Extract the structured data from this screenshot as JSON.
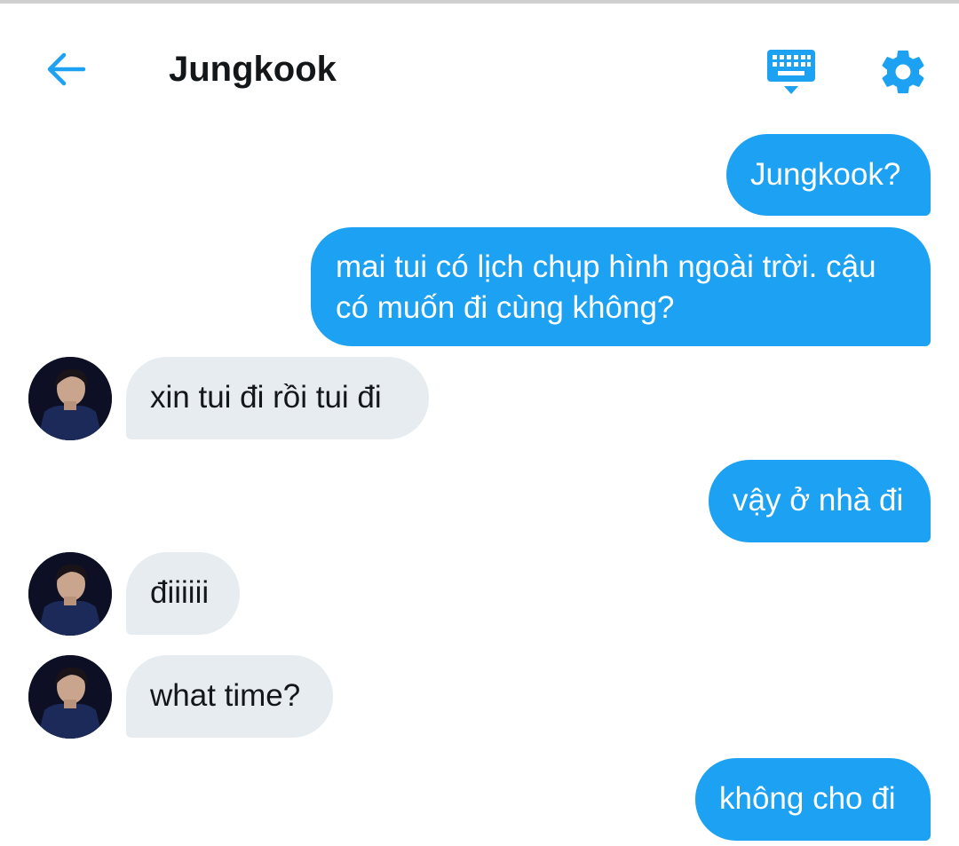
{
  "header": {
    "title": "Jungkook",
    "back_icon": "arrow-left-icon",
    "keyboard_icon": "keyboard-icon",
    "settings_icon": "gear-icon",
    "accent_color": "#1da1f2"
  },
  "messages": [
    {
      "direction": "outgoing",
      "text": "Jungkook?"
    },
    {
      "direction": "outgoing",
      "line1": "mai tui có lịch chụp hình ngoài trời. cậu",
      "line2": "có muốn đi cùng không?"
    },
    {
      "direction": "incoming",
      "text": "xin tui đi rồi  tui đi"
    },
    {
      "direction": "outgoing",
      "text": "vậy ở nhà đi"
    },
    {
      "direction": "incoming",
      "text": "điiiiii"
    },
    {
      "direction": "incoming",
      "text": "what time?"
    },
    {
      "direction": "outgoing",
      "text": "không cho đi"
    }
  ],
  "colors": {
    "outgoing_bubble": "#1da1f2",
    "incoming_bubble": "#e6ecf0"
  }
}
